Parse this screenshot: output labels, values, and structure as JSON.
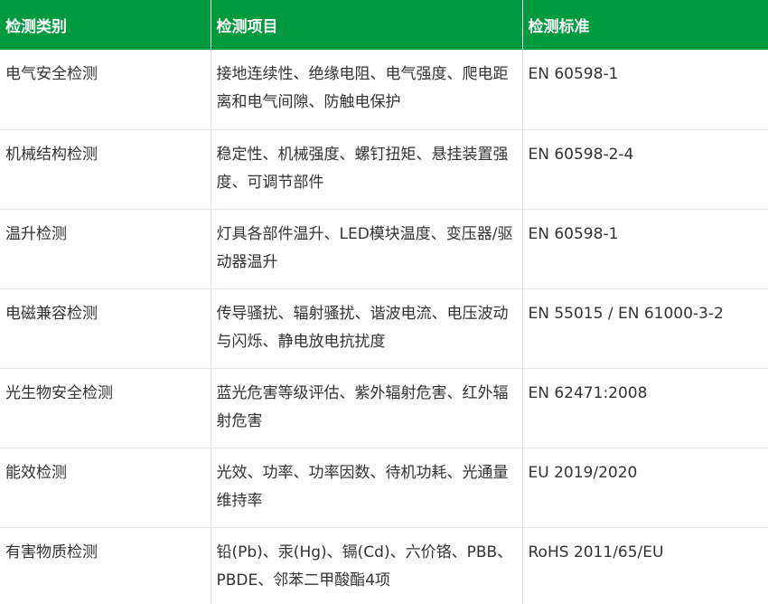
{
  "table": {
    "headers": [
      "检测类别",
      "检测项目",
      "检测标准"
    ],
    "rows": [
      {
        "category": "电气安全检测",
        "items": "接地连续性、绝缘电阻、电气强度、爬电距离和电气间隙、防触电保护",
        "standard": "EN 60598-1"
      },
      {
        "category": "机械结构检测",
        "items": "稳定性、机械强度、螺钉扭矩、悬挂装置强度、可调节部件",
        "standard": "EN 60598-2-4"
      },
      {
        "category": "温升检测",
        "items": "灯具各部件温升、LED模块温度、变压器/驱动器温升",
        "standard": "EN 60598-1"
      },
      {
        "category": "电磁兼容检测",
        "items": "传导骚扰、辐射骚扰、谐波电流、电压波动与闪烁、静电放电抗扰度",
        "standard": "EN 55015 / EN 61000-3-2"
      },
      {
        "category": "光生物安全检测",
        "items": "蓝光危害等级评估、紫外辐射危害、红外辐射危害",
        "standard": "EN 62471:2008"
      },
      {
        "category": "能效检测",
        "items": "光效、功率、功率因数、待机功耗、光通量维持率",
        "standard": "EU 2019/2020"
      },
      {
        "category": "有害物质检测",
        "items": "铅(Pb)、汞(Hg)、镉(Cd)、六价铬、PBB、PBDE、邻苯二甲酸酯4项",
        "standard": "RoHS 2011/65/EU"
      }
    ]
  },
  "colors": {
    "header_bg": "#009a3e",
    "header_text": "#ffffff",
    "body_text": "#333333",
    "grid": "#e2e2e2"
  }
}
